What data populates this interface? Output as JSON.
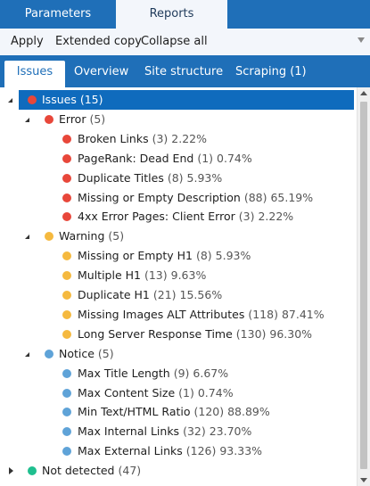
{
  "top_tabs": [
    {
      "label": "Parameters",
      "active": false
    },
    {
      "label": "Reports",
      "active": true
    }
  ],
  "toolbar": {
    "apply_label": "Apply",
    "extended_copy_label": "Extended copy",
    "collapse_all_label": "Collapse all",
    "menu_icon": "chevron-down-icon"
  },
  "sub_tabs": [
    {
      "label": "Issues",
      "active": true
    },
    {
      "label": "Overview",
      "active": false
    },
    {
      "label": "Site structure",
      "active": false
    },
    {
      "label": "Scraping (1)",
      "active": false
    }
  ],
  "colors": {
    "accent": "#1f6fb8",
    "selection": "#0f6bbd",
    "issues": "#e8473a",
    "error": "#e8473a",
    "warning": "#f5b93f",
    "notice": "#5fa3d8",
    "not_detected": "#1fbf8f"
  },
  "tree": [
    {
      "level": 0,
      "expander": "open",
      "color": "#e8473a",
      "label": "Issues",
      "count": "(15)",
      "pct": "",
      "selected": true
    },
    {
      "level": 1,
      "expander": "open",
      "color": "#e8473a",
      "label": "Error",
      "count": "(5)",
      "pct": "",
      "selected": false
    },
    {
      "level": 2,
      "expander": "",
      "color": "#e8473a",
      "label": "Broken Links",
      "count": "(3)",
      "pct": "2.22%",
      "selected": false
    },
    {
      "level": 2,
      "expander": "",
      "color": "#e8473a",
      "label": "PageRank: Dead End",
      "count": "(1)",
      "pct": "0.74%",
      "selected": false
    },
    {
      "level": 2,
      "expander": "",
      "color": "#e8473a",
      "label": "Duplicate Titles",
      "count": "(8)",
      "pct": "5.93%",
      "selected": false
    },
    {
      "level": 2,
      "expander": "",
      "color": "#e8473a",
      "label": "Missing or Empty Description",
      "count": "(88)",
      "pct": "65.19%",
      "selected": false
    },
    {
      "level": 2,
      "expander": "",
      "color": "#e8473a",
      "label": "4xx Error Pages: Client Error",
      "count": "(3)",
      "pct": "2.22%",
      "selected": false
    },
    {
      "level": 1,
      "expander": "open",
      "color": "#f5b93f",
      "label": "Warning",
      "count": "(5)",
      "pct": "",
      "selected": false
    },
    {
      "level": 2,
      "expander": "",
      "color": "#f5b93f",
      "label": "Missing or Empty H1",
      "count": "(8)",
      "pct": "5.93%",
      "selected": false
    },
    {
      "level": 2,
      "expander": "",
      "color": "#f5b93f",
      "label": "Multiple H1",
      "count": "(13)",
      "pct": "9.63%",
      "selected": false
    },
    {
      "level": 2,
      "expander": "",
      "color": "#f5b93f",
      "label": "Duplicate H1",
      "count": "(21)",
      "pct": "15.56%",
      "selected": false
    },
    {
      "level": 2,
      "expander": "",
      "color": "#f5b93f",
      "label": "Missing Images ALT Attributes",
      "count": "(118)",
      "pct": "87.41%",
      "selected": false
    },
    {
      "level": 2,
      "expander": "",
      "color": "#f5b93f",
      "label": "Long Server Response Time",
      "count": "(130)",
      "pct": "96.30%",
      "selected": false
    },
    {
      "level": 1,
      "expander": "open",
      "color": "#5fa3d8",
      "label": "Notice",
      "count": "(5)",
      "pct": "",
      "selected": false
    },
    {
      "level": 2,
      "expander": "",
      "color": "#5fa3d8",
      "label": "Max Title Length",
      "count": "(9)",
      "pct": "6.67%",
      "selected": false
    },
    {
      "level": 2,
      "expander": "",
      "color": "#5fa3d8",
      "label": "Max Content Size",
      "count": "(1)",
      "pct": "0.74%",
      "selected": false
    },
    {
      "level": 2,
      "expander": "",
      "color": "#5fa3d8",
      "label": "Min Text/HTML Ratio",
      "count": "(120)",
      "pct": "88.89%",
      "selected": false
    },
    {
      "level": 2,
      "expander": "",
      "color": "#5fa3d8",
      "label": "Max Internal Links",
      "count": "(32)",
      "pct": "23.70%",
      "selected": false
    },
    {
      "level": 2,
      "expander": "",
      "color": "#5fa3d8",
      "label": "Max External Links",
      "count": "(126)",
      "pct": "93.33%",
      "selected": false
    },
    {
      "level": 0,
      "expander": "closed",
      "color": "#1fbf8f",
      "label": "Not detected",
      "count": "(47)",
      "pct": "",
      "selected": false
    }
  ]
}
